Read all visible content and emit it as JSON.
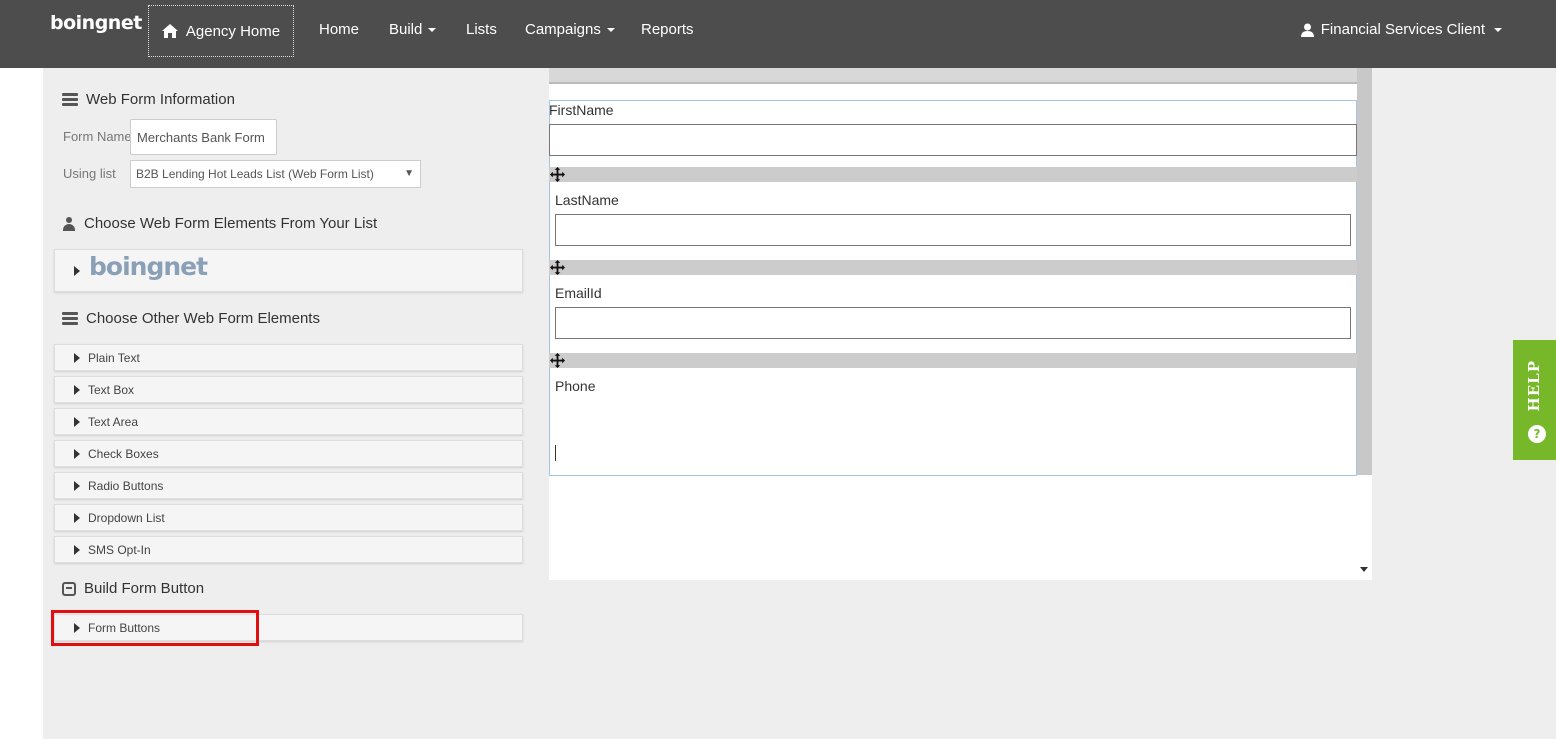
{
  "nav": {
    "logo": "boingnet",
    "agency_home": "Agency Home",
    "items": [
      "Home",
      "Build",
      "Lists",
      "Campaigns",
      "Reports"
    ],
    "user": "Financial Services Client"
  },
  "sidebar": {
    "web_form_info_title": "Web Form Information",
    "form_name_label": "Form Name",
    "form_name_value": "Merchants Bank Form",
    "using_list_label": "Using list",
    "using_list_value": "B2B Lending Hot Leads List (Web Form List)",
    "choose_list_title": "Choose Web Form Elements From Your List",
    "list_logo": "boingnet",
    "choose_other_title": "Choose Other Web Form Elements",
    "elements": [
      "Plain Text",
      "Text Box",
      "Text Area",
      "Check Boxes",
      "Radio Buttons",
      "Dropdown List",
      "SMS Opt-In"
    ],
    "build_button_title": "Build Form Button",
    "form_buttons": "Form Buttons"
  },
  "preview": {
    "fields": [
      "FirstName",
      "LastName",
      "EmailId",
      "Phone"
    ]
  },
  "help": {
    "label": "HELP",
    "icon": "?"
  },
  "colors": {
    "nav_bg": "#4d4d4d",
    "help_green": "#76b82a",
    "highlight_red": "#e01010"
  }
}
